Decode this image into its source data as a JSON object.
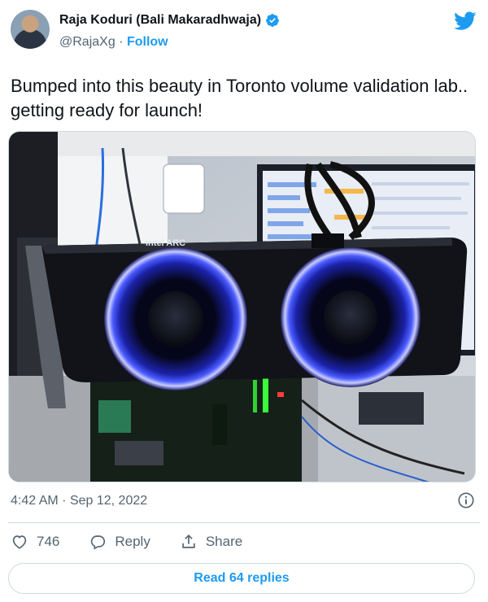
{
  "author": {
    "name": "Raja Koduri (Bali Makaradhwaja)",
    "handle": "@RajaXg",
    "separator": "·",
    "follow_label": "Follow"
  },
  "tweet": {
    "text": "Bumped into this beauty in Toronto volume validation lab.. getting ready for  launch!"
  },
  "media": {
    "card_brand_label": "intel ARC"
  },
  "meta": {
    "time": "4:42 AM",
    "separator": "·",
    "date": "Sep 12, 2022"
  },
  "actions": {
    "like_count": "746",
    "reply_label": "Reply",
    "share_label": "Share"
  },
  "replies_button": {
    "label": "Read 64 replies"
  },
  "colors": {
    "accent": "#1d9bf0",
    "text_primary": "#0f1419",
    "text_secondary": "#536471",
    "fan_glow": "#3a4bff",
    "led_green": "#39ff3a"
  }
}
